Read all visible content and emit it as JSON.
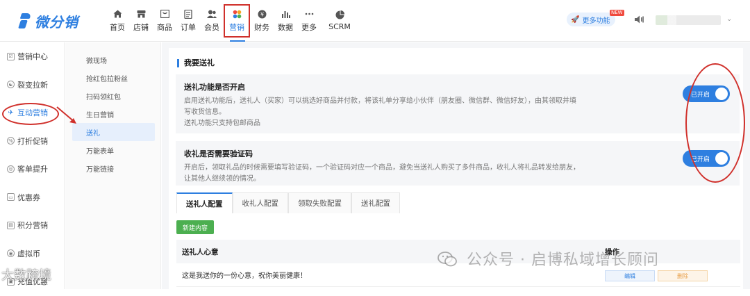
{
  "app": {
    "logo_text": "微分销"
  },
  "nav": [
    {
      "label": "首页",
      "icon": "home-icon"
    },
    {
      "label": "店铺",
      "icon": "store-icon"
    },
    {
      "label": "商品",
      "icon": "goods-icon"
    },
    {
      "label": "订单",
      "icon": "order-icon"
    },
    {
      "label": "会员",
      "icon": "member-icon"
    },
    {
      "label": "营销",
      "icon": "marketing-icon"
    },
    {
      "label": "财务",
      "icon": "finance-icon"
    },
    {
      "label": "数据",
      "icon": "chart-icon"
    },
    {
      "label": "更多",
      "icon": "more-dots-icon"
    },
    {
      "label": "SCRM",
      "icon": "pie-icon"
    }
  ],
  "header": {
    "more_label": "更多功能",
    "new_badge": "NEW"
  },
  "sidebar": [
    {
      "label": "营销中心"
    },
    {
      "label": "裂变拉新"
    },
    {
      "label": "互动营销"
    },
    {
      "label": "打折促销"
    },
    {
      "label": "客单提升"
    },
    {
      "label": "优惠券"
    },
    {
      "label": "积分营销"
    },
    {
      "label": "虚拟币"
    },
    {
      "label": "充值优惠"
    }
  ],
  "subnav": [
    {
      "label": "微现场"
    },
    {
      "label": "抢红包拉粉丝"
    },
    {
      "label": "扫码领红包"
    },
    {
      "label": "生日营销"
    },
    {
      "label": "送礼"
    },
    {
      "label": "万能表单"
    },
    {
      "label": "万能链接"
    }
  ],
  "page": {
    "title": "我要送礼",
    "settings": [
      {
        "title": "送礼功能是否开启",
        "desc1": "启用送礼功能后，送礼人（买家）可以挑选好商品并付款，将该礼单分享给小伙伴（朋友圈、微信群、微信好友），由其领取并填",
        "desc2": "写收货信息。",
        "desc3": "送礼功能只支持包邮商品",
        "toggle": "已开启"
      },
      {
        "title": "收礼是否需要验证码",
        "desc1": "开启后，领取礼品的时候需要填写验证码，一个验证码对应一个商品，避免当送礼人购买了多件商品，收礼人将礼品转发给朋友，",
        "desc2": "让其他人继续领的情况。",
        "toggle": "已开启"
      }
    ],
    "tabs": [
      "送礼人配置",
      "收礼人配置",
      "领取失败配置",
      "送礼配置"
    ],
    "new_button": "新建内容",
    "table": {
      "col_message": "送礼人心意",
      "col_action": "操作",
      "rows": [
        {
          "message": "这是我送你的一份心意，祝你美丽健康！",
          "edit": "编辑",
          "delete": "删除"
        }
      ]
    }
  },
  "watermarks": {
    "right": "公众号 · 启博私域增长顾问",
    "left": "大数跨境"
  },
  "colors": {
    "accent": "#2e7fe0",
    "annotation": "#d0302b",
    "new_button": "#4caf50"
  }
}
